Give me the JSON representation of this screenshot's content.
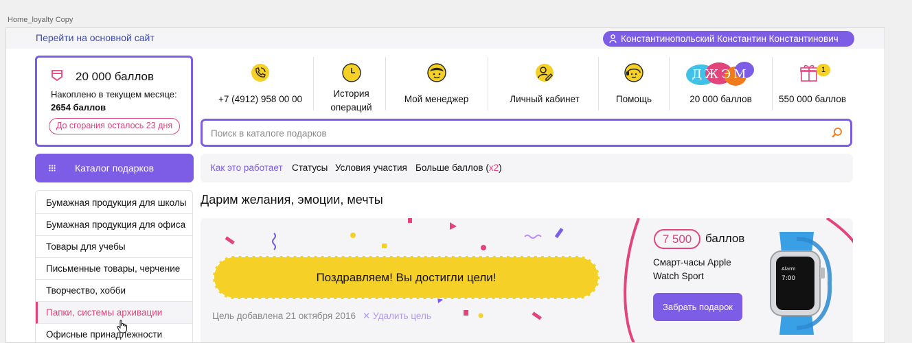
{
  "window": {
    "caption": "Home_loyalty Copy"
  },
  "topbar": {
    "back_link": "Перейти на основной сайт",
    "user_name": "Константинопольский Константин Константинович"
  },
  "balance": {
    "points": "20 000 баллов",
    "accumulated_label": "Накоплено в текущем месяце:",
    "accumulated_value": "2654 баллов",
    "expire_text": "До сгорания осталось 23 дня"
  },
  "nav": [
    {
      "label": "+7 (4912) 958 00 00",
      "icon": "phone-icon"
    },
    {
      "label": "История операций",
      "icon": "clock-icon"
    },
    {
      "label": "Мой менеджер",
      "icon": "manager-icon"
    },
    {
      "label": "Личный кабинет",
      "icon": "user-edit-icon"
    },
    {
      "label": "Помощь",
      "icon": "headset-icon"
    },
    {
      "label": "20 000 баллов",
      "logo_text": "ДЖЭМ",
      "icon": "djem-logo"
    },
    {
      "label": "550 000 баллов",
      "badge": "1",
      "icon": "gift-icon"
    }
  ],
  "search": {
    "placeholder": "Поиск в каталоге подарков"
  },
  "catalog_button": "Каталог подарков",
  "tabs": [
    {
      "label": "Как это работает",
      "active": true
    },
    {
      "label": "Статусы"
    },
    {
      "label": "Условия участия"
    },
    {
      "label": "Больше баллов (",
      "suffix": "x2",
      "close": ")"
    }
  ],
  "categories": [
    "Бумажная продукция для школы",
    "Бумажная продукция для офиса",
    "Товары для учебы",
    "Письменные товары, черчение",
    "Творчество, хобби",
    "Папки, системы архивации",
    "Офисные принадлежности"
  ],
  "selected_category": "Папки, системы архивации",
  "headline": "Дарим желания, эмоции, мечты",
  "banner": {
    "goal_text": "Поздравляем! Вы достигли цели!",
    "goal_date": "Цель добавлена 21 октября 2016",
    "delete_label": "✕ Удалить цель",
    "price": "7 500",
    "price_unit": "баллов",
    "product_name": "Смарт-часы Apple Watch Sport",
    "take_button": "Забрать подарок"
  },
  "colors": {
    "accent": "#7d5ce6",
    "pink": "#e2447c",
    "yellow": "#f5d026"
  }
}
